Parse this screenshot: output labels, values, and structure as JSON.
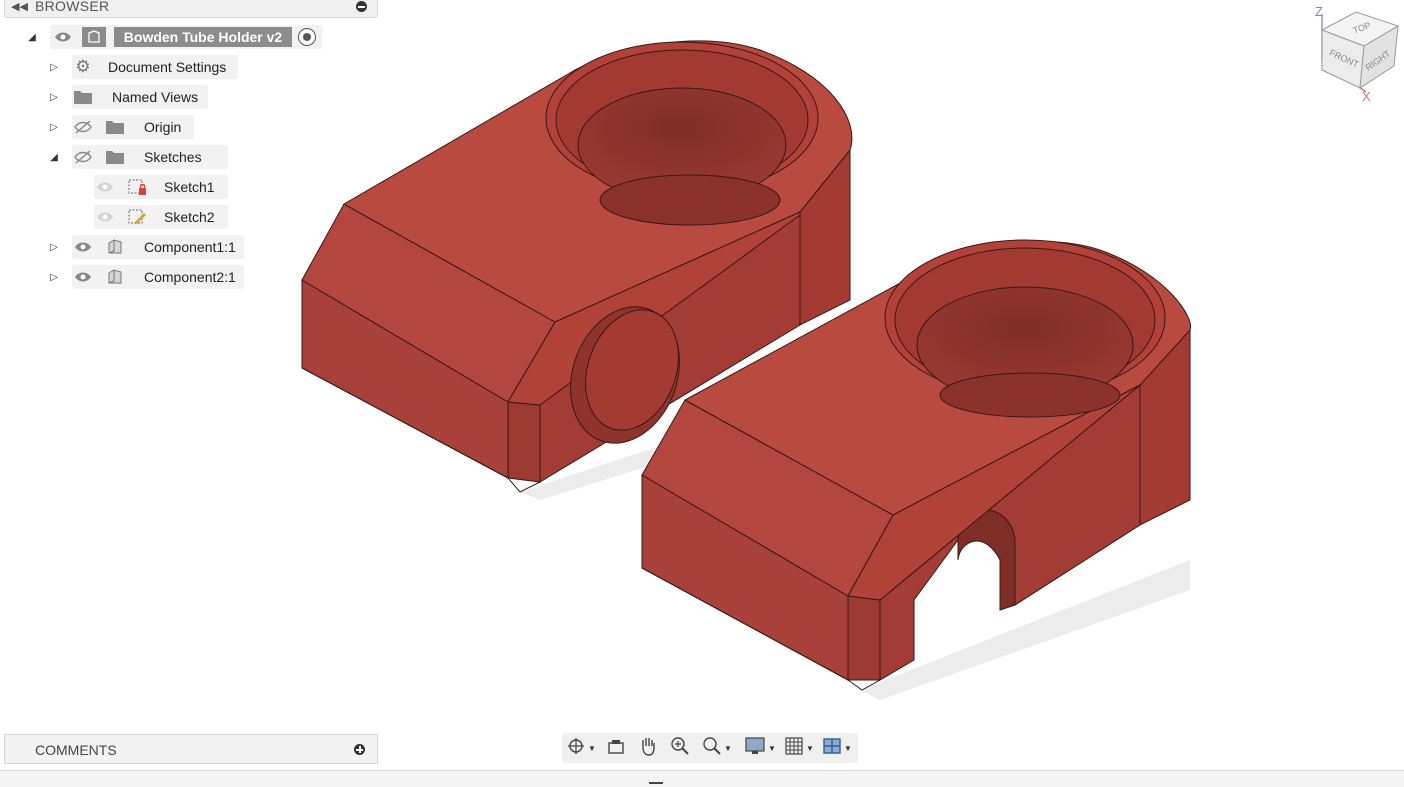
{
  "browser": {
    "title": "BROWSER",
    "root": {
      "label": "Bowden Tube Holder v2"
    },
    "items": [
      {
        "label": "Document Settings"
      },
      {
        "label": "Named Views"
      },
      {
        "label": "Origin"
      },
      {
        "label": "Sketches"
      },
      {
        "label": "Sketch1"
      },
      {
        "label": "Sketch2"
      },
      {
        "label": "Component1:1"
      },
      {
        "label": "Component2:1"
      }
    ]
  },
  "comments": {
    "title": "COMMENTS"
  },
  "viewcube": {
    "top": "TOP",
    "front": "FRONT",
    "right": "RIGHT",
    "axis_z": "Z",
    "axis_x": "X"
  },
  "toolbar": {
    "tools": [
      "orbit-icon",
      "look-at-icon",
      "pan-icon",
      "zoom-icon",
      "fit-icon",
      "display-settings-icon",
      "grid-icon",
      "viewports-icon"
    ]
  },
  "colors": {
    "model_top": "#b94a40",
    "model_side": "#a63d34",
    "model_dark": "#8e332c",
    "panel_bg": "#f2f2f2",
    "selected": "#8c8c8c"
  }
}
